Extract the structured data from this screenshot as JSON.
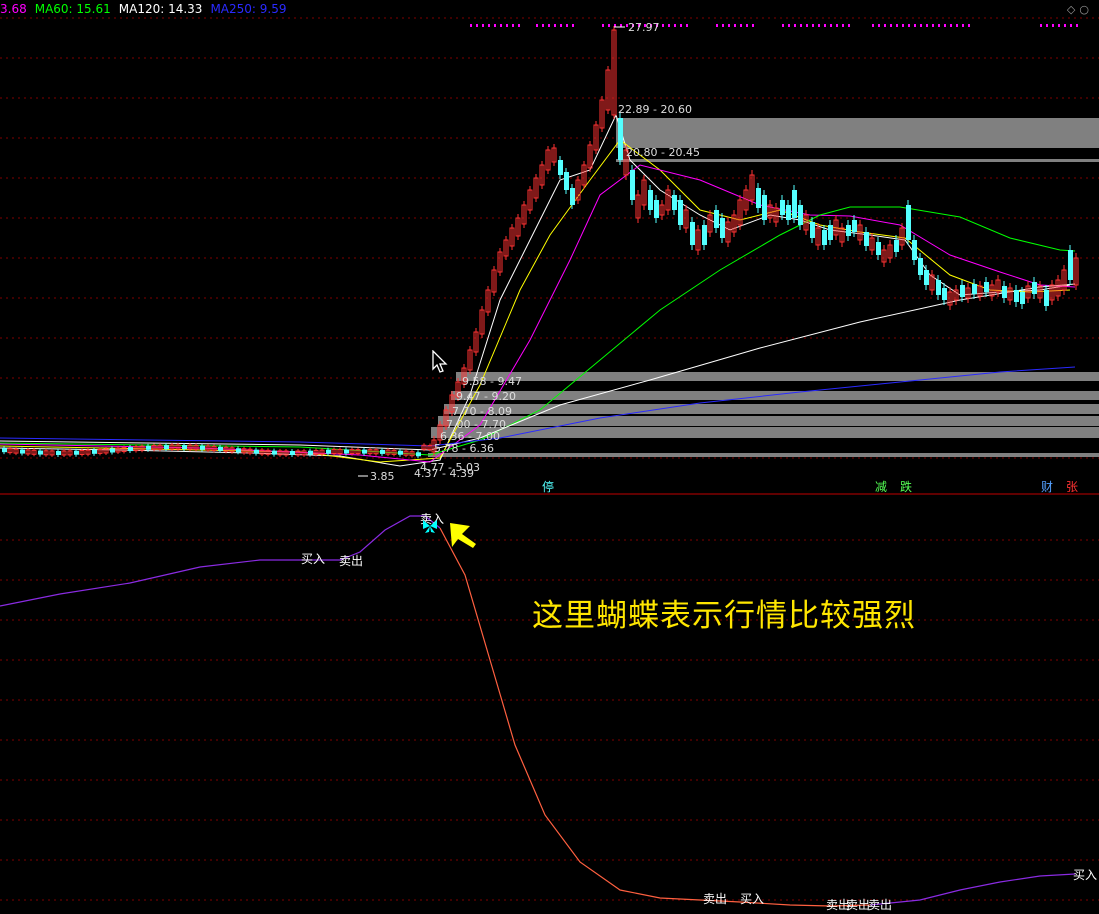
{
  "legend": [
    {
      "label": "3.68",
      "color": "#ff00ff"
    },
    {
      "label": "MA60: 15.61",
      "color": "#00ff00"
    },
    {
      "label": "MA120: 14.33",
      "color": "#ffffff"
    },
    {
      "label": "MA250: 9.59",
      "color": "#2a2aff"
    }
  ],
  "corner_icons": [
    "diamond-icon",
    "circle-icon"
  ],
  "annotation": "这里蝴蝶表示行情比较强烈",
  "colors": {
    "up": "#ff3232",
    "down": "#54ffff",
    "grid": "#800000",
    "ma5": "#ffffff",
    "ma10": "#ffff00",
    "ma20": "#ff00ff",
    "ma60": "#00ff00",
    "ma120": "#ffffff",
    "ma250": "#2a2aff",
    "indicator_up": "#8a2be2",
    "indicator_down": "#ff6040",
    "signal_text": "#ffffff",
    "zone_fill": "#808080",
    "accent_arrow": "#ffff00",
    "butterfly": "#00ffff"
  },
  "chart_data": {
    "type": "candlestick",
    "price_labels": [
      "27.97",
      "22.89 - 20.60",
      "20.80 - 20.45",
      "9.58 - 9.47",
      "9.47 - 9.20",
      "7.70 - 8.09",
      "7.00 - 7.70",
      "6.36 - 7.00",
      "5.78 - 6.36",
      "4.77 - 5.03",
      "4.37 - 4.39",
      "3.85"
    ],
    "zone_labels": [
      "22.89 - 20.60",
      "20.80 - 20.45",
      "9.58 - 9.47",
      "9.47 - 9.20",
      "7.70 - 8.09",
      "7.00 - 7.70",
      "6.36 - 7.00",
      "5.78 - 6.36",
      "4.77 - 5.03",
      "4.37 - 4.39"
    ],
    "event_markers": [
      {
        "label": "停",
        "color": "#54ffff"
      },
      {
        "label": "减",
        "color": "#54ff54"
      },
      {
        "label": "跌",
        "color": "#54ff54"
      },
      {
        "label": "财",
        "color": "#54a0ff"
      },
      {
        "label": "张",
        "color": "#ff3232"
      }
    ],
    "indicator_signals": [
      "买入",
      "卖出",
      "卖入",
      "卖出",
      "买入",
      "卖出",
      "卖出",
      "卖出",
      "买入"
    ]
  }
}
